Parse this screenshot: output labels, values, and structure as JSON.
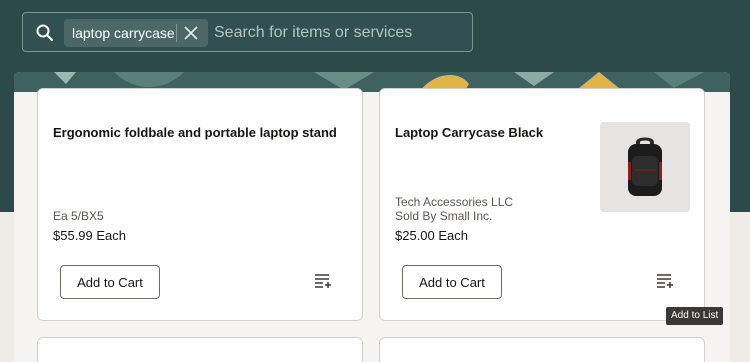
{
  "search": {
    "placeholder": "Search for items or services",
    "chip_label": "laptop carrycase"
  },
  "products": [
    {
      "title": "Ergonomic foldbale and portable laptop stand",
      "uom": "Ea 5/BX5",
      "price": "$55.99 Each",
      "add_to_cart": "Add to Cart"
    },
    {
      "title": "Laptop Carrycase Black",
      "supplier": "Tech Accessories LLC",
      "sold_by_prefix": "Sold By",
      "sold_by_name": "Small Inc.",
      "price": "$25.00 Each",
      "add_to_cart": "Add to Cart",
      "image_icon": "backpack-image"
    }
  ],
  "tooltip": "Add to List",
  "colors": {
    "header_bg": "#2d4a4b",
    "chip_bg": "#4b6767",
    "card_bg": "#ffffff",
    "page_bg": "#efebe7"
  }
}
